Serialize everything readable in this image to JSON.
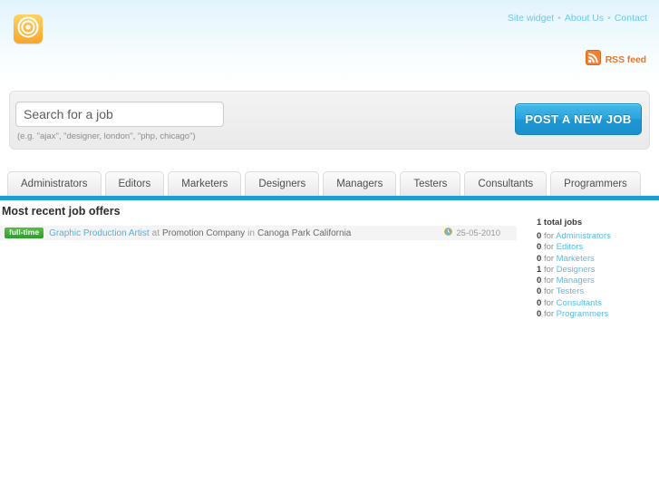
{
  "header": {
    "logo_icon": "bullseye-target-icon",
    "topnav": [
      {
        "label": "Site widget"
      },
      {
        "label": "About Us"
      },
      {
        "label": "Contact"
      }
    ],
    "separator": "•",
    "rss": {
      "icon": "rss-feed-icon",
      "label": "RSS feed"
    }
  },
  "search": {
    "placeholder": "Search for a job",
    "value": "",
    "hint": "(e.g. \"ajax\", \"designer, london\", \"php, chicago\")",
    "post_button_label": "POST A NEW JOB"
  },
  "tabs": [
    {
      "label": "Administrators"
    },
    {
      "label": "Editors"
    },
    {
      "label": "Marketers"
    },
    {
      "label": "Designers"
    },
    {
      "label": "Managers"
    },
    {
      "label": "Testers"
    },
    {
      "label": "Consultants"
    },
    {
      "label": "Programmers"
    }
  ],
  "main": {
    "section_title": "Most recent job offers",
    "jobs": [
      {
        "badge": "full-time",
        "title": "Graphic Production Artist",
        "at": "at",
        "company": "Promotion Company",
        "in": "in",
        "location": "Canoga Park California",
        "date_icon": "clock-icon",
        "date": "25-05-2010"
      }
    ]
  },
  "sidebar": {
    "total_label": "1 total jobs",
    "for_word": "for",
    "counts": [
      {
        "count": "0",
        "label": "Administrators"
      },
      {
        "count": "0",
        "label": "Editors"
      },
      {
        "count": "0",
        "label": "Marketers"
      },
      {
        "count": "1",
        "label": "Designers"
      },
      {
        "count": "0",
        "label": "Managers"
      },
      {
        "count": "0",
        "label": "Testers"
      },
      {
        "count": "0",
        "label": "Consultants"
      },
      {
        "count": "0",
        "label": "Programmers"
      }
    ]
  },
  "colors": {
    "accent_blue": "#1d9ed7",
    "link_blue": "#5bbbe6",
    "brand_orange": "#f9a528",
    "badge_green": "#3fae3f",
    "rss_orange": "#e8762c"
  }
}
